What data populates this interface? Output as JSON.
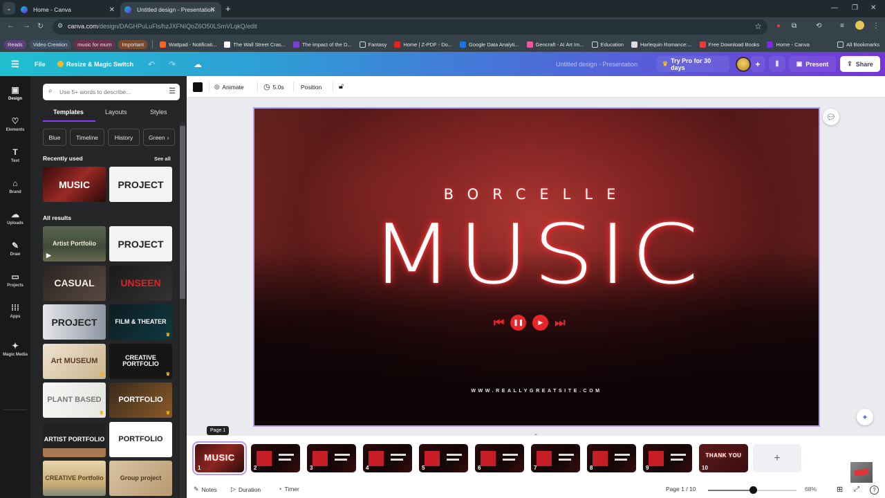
{
  "browser": {
    "tabs": [
      {
        "title": "Home - Canva",
        "active": false
      },
      {
        "title": "Untitled design - Presentation",
        "active": true
      }
    ],
    "url_domain": "canva.com",
    "url_path": "/design/DAGHPuLuFls/hzJXFNIQoZ6O50LSmVLqkQ/edit",
    "bookmarks_chips": [
      {
        "label": "Reads",
        "bg": "#5b3f7a"
      },
      {
        "label": "Video Creation",
        "bg": "#3c4f5e"
      },
      {
        "label": "music for mum",
        "bg": "#6a2f4a"
      },
      {
        "label": "Important",
        "bg": "#7a4a2f"
      }
    ],
    "bookmarks": [
      {
        "label": "Wattpad - Notificati...",
        "color": "#ff6122"
      },
      {
        "label": "The Wall Street Cras...",
        "color": "#ffffff"
      },
      {
        "label": "The impact of the D...",
        "color": "#7b3fd0"
      },
      {
        "label": "Fantasy",
        "color": "folder"
      },
      {
        "label": "Home | Z-PDF - Do...",
        "color": "#e02424"
      },
      {
        "label": "Google Data Analyti...",
        "color": "#1a73e8"
      },
      {
        "label": "Gencraft - AI Art Im...",
        "color": "#e85aa0"
      },
      {
        "label": "Education",
        "color": "folder"
      },
      {
        "label": "Harlequin Romance:...",
        "color": "#dddddd"
      },
      {
        "label": "Free Download Books",
        "color": "#e04040"
      },
      {
        "label": "Home - Canva",
        "color": "#7d2ae8"
      }
    ],
    "all_bookmarks": "All Bookmarks"
  },
  "canva_header": {
    "file": "File",
    "resize": "Resize & Magic Switch",
    "doc_title": "Untitled design - Presentation",
    "try_pro": "Try Pro for 30 days",
    "present": "Present",
    "share": "Share"
  },
  "rail": [
    {
      "label": "Design",
      "icon": "▣"
    },
    {
      "label": "Elements",
      "icon": "♡"
    },
    {
      "label": "Text",
      "icon": "T"
    },
    {
      "label": "Brand",
      "icon": "⌂"
    },
    {
      "label": "Uploads",
      "icon": "☁"
    },
    {
      "label": "Draw",
      "icon": "✎"
    },
    {
      "label": "Projects",
      "icon": "▭"
    },
    {
      "label": "Apps",
      "icon": "⁞⁞⁞"
    },
    {
      "label": "Magic Media",
      "icon": "✦"
    }
  ],
  "panel": {
    "search_placeholder": "Use 5+ words to describe...",
    "tabs": [
      "Templates",
      "Layouts",
      "Styles"
    ],
    "chips": [
      "Blue",
      "Timeline",
      "History",
      "Green"
    ],
    "recently_used": "Recently used",
    "see_all": "See all",
    "all_results": "All results",
    "recent": [
      {
        "text": "MUSIC",
        "bg": "linear-gradient(135deg,#3a0c0e,#9a2a24 50%,#2a0a0a)",
        "fg": "#ffffff"
      },
      {
        "text": "PROJECT",
        "bg": "#f3f3f3",
        "fg": "#222222"
      }
    ],
    "results": [
      {
        "text": "Artist Portfolio",
        "bg": "linear-gradient(180deg,#5a6650,#3f4a3a 60%,#6b6a4e)",
        "fg": "#efe9d8",
        "play": true
      },
      {
        "text": "PROJECT",
        "bg": "#f3f3f3",
        "fg": "#222222"
      },
      {
        "text": "CASUAL",
        "bg": "linear-gradient(135deg,#2a2320,#5a4a42)",
        "fg": "#f3eee8"
      },
      {
        "text": "UNSEEN",
        "bg": "linear-gradient(135deg,#1a1a1a,#333)",
        "fg": "#d8252c"
      },
      {
        "text": "PROJECT",
        "bg": "linear-gradient(90deg,#e6e7ea,#8d95a2)",
        "fg": "#222222"
      },
      {
        "text": "FILM & THEATER",
        "bg": "linear-gradient(135deg,#0e1c22,#0e3a40)",
        "fg": "#ffffff",
        "crown": true
      },
      {
        "text": "Art MUSEUM",
        "bg": "linear-gradient(135deg,#efe3cf,#c9b48f)",
        "fg": "#5a3a22",
        "crown": true
      },
      {
        "text": "CREATIVE PORTFOLIO",
        "bg": "#161616",
        "fg": "#ffffff",
        "crown": true
      },
      {
        "text": "PLANT BASED",
        "bg": "linear-gradient(90deg,#f5f5f3,#e6e6e3)",
        "fg": "#777777",
        "crown": true
      },
      {
        "text": "PORTFOLIO",
        "bg": "linear-gradient(135deg,#3a2a1a,#8a5a2a)",
        "fg": "#ffffff",
        "crown": true
      },
      {
        "text": "ARTIST PORTFOLIO",
        "bg": "linear-gradient(180deg,#222 75%,#a97a52 75%)",
        "fg": "#ffffff"
      },
      {
        "text": "PORTFOLIO",
        "bg": "#ffffff",
        "fg": "#222222"
      },
      {
        "text": "CREATIVE Portfolio",
        "bg": "linear-gradient(180deg,#e8d5ae,#c6a972 70%,#7c8a78)",
        "fg": "#5a3f20"
      },
      {
        "text": "Group project",
        "bg": "linear-gradient(135deg,#d9c4a4,#b89a72)",
        "fg": "#4a3520"
      }
    ]
  },
  "toolbar": {
    "animate": "Animate",
    "duration": "5.0s",
    "position": "Position"
  },
  "slide": {
    "brand": "BORCELLE",
    "title": "MUSIC",
    "website": "WWW.REALLYGREATSITE.COM"
  },
  "filmstrip": {
    "tooltip": "Page 1",
    "pages": [
      {
        "num": "1",
        "caption": "MUSIC",
        "selected": true
      },
      {
        "num": "2",
        "caption": ""
      },
      {
        "num": "3",
        "caption": ""
      },
      {
        "num": "4",
        "caption": ""
      },
      {
        "num": "5",
        "caption": ""
      },
      {
        "num": "6",
        "caption": ""
      },
      {
        "num": "7",
        "caption": ""
      },
      {
        "num": "8",
        "caption": ""
      },
      {
        "num": "9",
        "caption": ""
      },
      {
        "num": "10",
        "caption": "THANK YOU"
      }
    ],
    "add": "+"
  },
  "footer": {
    "notes": "Notes",
    "duration": "Duration",
    "timer": "Timer",
    "page_indicator": "Page 1 / 10",
    "zoom_value": 68,
    "zoom_label": "68%"
  }
}
